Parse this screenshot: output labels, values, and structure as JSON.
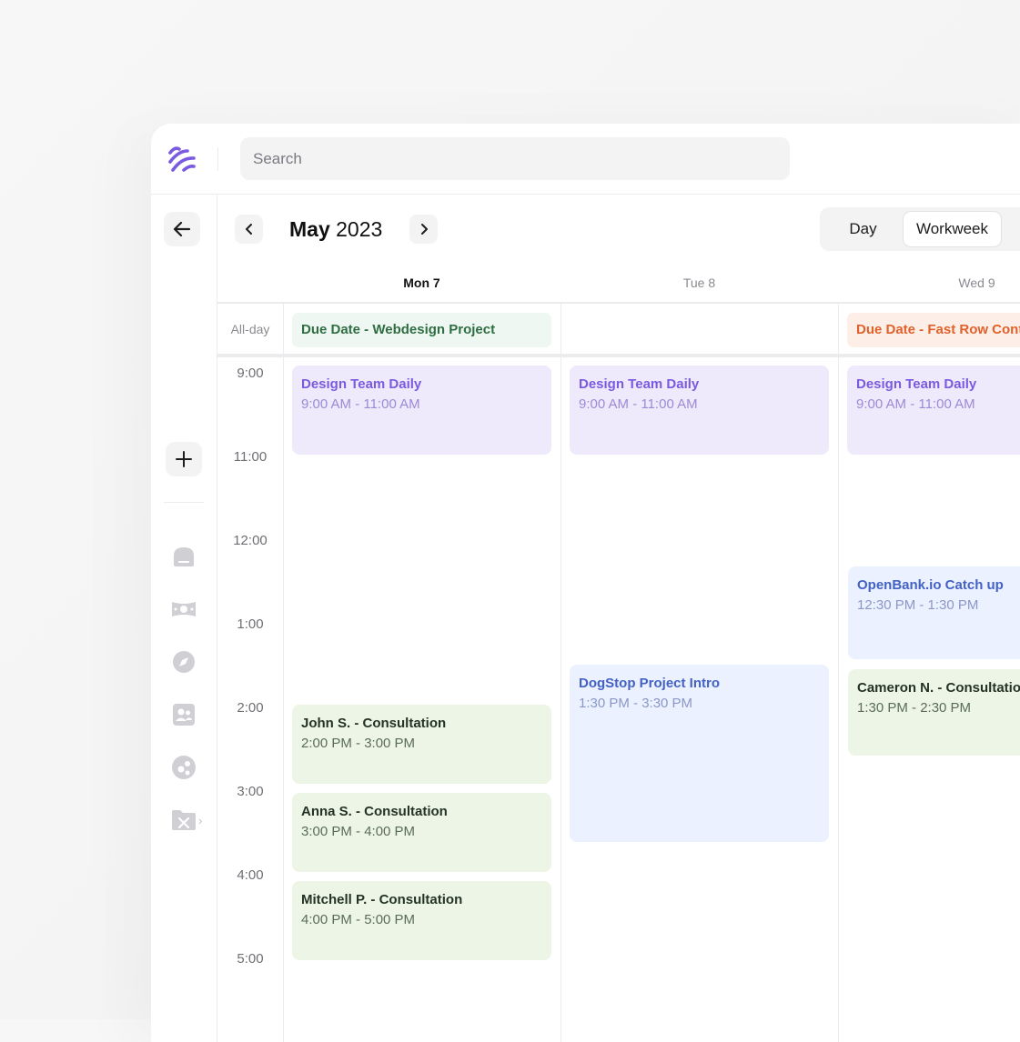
{
  "search": {
    "placeholder": "Search"
  },
  "calendar": {
    "month": "May",
    "year": "2023",
    "views": [
      "Day",
      "Workweek"
    ],
    "active_view": "Workweek"
  },
  "days": [
    {
      "label": "Mon 7",
      "today": true
    },
    {
      "label": "Tue 8",
      "today": false
    },
    {
      "label": "Wed 9",
      "today": false
    }
  ],
  "allday_label": "All-day",
  "allday_events": [
    {
      "title": "Due Date - Webdesign Project",
      "color": "#2f6e43"
    },
    {
      "title": "Due Date - Fast Row Contr",
      "color": "#e0612a"
    }
  ],
  "time_labels": [
    "9:00",
    "11:00",
    "12:00",
    "1:00",
    "2:00",
    "3:00",
    "4:00",
    "5:00"
  ],
  "events": {
    "mon": [
      {
        "title": "Design Team Daily",
        "time": "9:00 AM - 11:00 AM",
        "color": "purple"
      },
      {
        "title": "John S. - Consultation",
        "time": "2:00 PM - 3:00 PM",
        "color": "green"
      },
      {
        "title": "Anna S. - Consultation",
        "time": "3:00 PM - 4:00 PM",
        "color": "green"
      },
      {
        "title": "Mitchell P. - Consultation",
        "time": "4:00 PM - 5:00 PM",
        "color": "green"
      }
    ],
    "tue": [
      {
        "title": "Design Team Daily",
        "time": "9:00 AM - 11:00 AM",
        "color": "purple"
      },
      {
        "title": "DogStop Project Intro",
        "time": "1:30 PM - 3:30 PM",
        "color": "blue"
      }
    ],
    "wed": [
      {
        "title": "Design Team Daily",
        "time": "9:00 AM - 11:00 AM",
        "color": "purple"
      },
      {
        "title": "OpenBank.io Catch up",
        "time": "12:30 PM - 1:30 PM",
        "color": "blue"
      },
      {
        "title": "Cameron N. - Consultation",
        "time": "1:30 PM - 2:30 PM",
        "color": "green"
      }
    ]
  },
  "sidebar_icons": [
    "home-icon",
    "money-icon",
    "compass-icon",
    "contacts-icon",
    "apps-icon",
    "tools-folder-icon"
  ],
  "colors": {
    "accent": "#7a5ae0",
    "border": "#ececee"
  }
}
